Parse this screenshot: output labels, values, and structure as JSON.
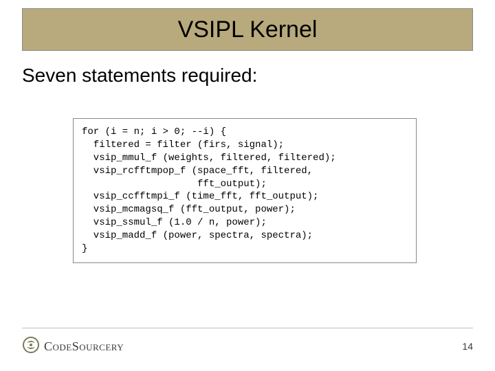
{
  "title": "VSIPL Kernel",
  "subtitle": "Seven statements required:",
  "code": "for (i = n; i > 0; --i) {\n  filtered = filter (firs, signal);\n  vsip_mmul_f (weights, filtered, filtered);\n  vsip_rcfftmpop_f (space_fft, filtered,\n                    fft_output);\n  vsip_ccfftmpi_f (time_fft, fft_output);\n  vsip_mcmagsq_f (fft_output, power);\n  vsip_ssmul_f (1.0 / n, power);\n  vsip_madd_f (power, spectra, spectra);\n}",
  "logo_text": "CodeSourcery",
  "page_number": "14"
}
